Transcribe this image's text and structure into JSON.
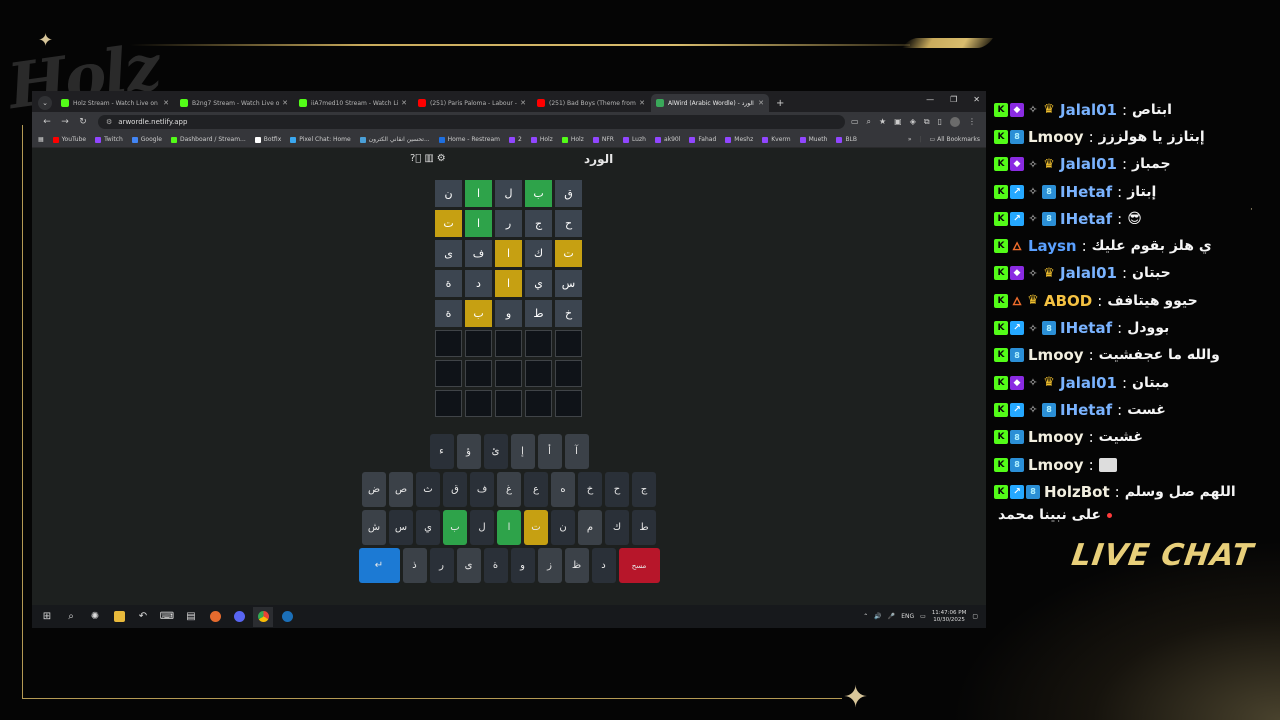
{
  "overlay": {
    "logo": "Holz",
    "live_chat_label": "LIVE CHAT",
    "gold": "#c9ab5c"
  },
  "browser": {
    "tabs": [
      {
        "title": "Holz Stream - Watch Live on Ki",
        "favicon_color": "#53fc18",
        "active": false
      },
      {
        "title": "B2ng7 Stream - Watch Live on",
        "favicon_color": "#53fc18",
        "active": false
      },
      {
        "title": "iiA7med10 Stream - Watch Live",
        "favicon_color": "#53fc18",
        "active": false
      },
      {
        "title": "(251) Paris Paloma - Labour - Y",
        "favicon_color": "#ff0000",
        "active": false
      },
      {
        "title": "(251) Bad Boys (Theme from Co",
        "favicon_color": "#ff0000",
        "active": false
      },
      {
        "title": "AlWird (Arabic Wordle) - الورد",
        "favicon_color": "#3aa85a",
        "active": true
      }
    ],
    "url": "arwordle.netlify.app",
    "bookmarks": [
      {
        "label": "YouTube",
        "color": "#ff0000"
      },
      {
        "label": "Twitch",
        "color": "#9146ff"
      },
      {
        "label": "Google",
        "color": "#4285f4"
      },
      {
        "label": "Dashboard / Stream...",
        "color": "#53fc18"
      },
      {
        "label": "Botfix",
        "color": "#ffffff"
      },
      {
        "label": "Pixel Chat: Home",
        "color": "#3aa8f0"
      },
      {
        "label": "تحسين انقاني الكترون...",
        "color": "#4aa0d8"
      },
      {
        "label": "Home - Restream",
        "color": "#1e6fe0"
      },
      {
        "label": "2",
        "color": "#9146ff"
      },
      {
        "label": "Holz",
        "color": "#9146ff"
      },
      {
        "label": "Holz",
        "color": "#53fc18"
      },
      {
        "label": "NFR",
        "color": "#9146ff"
      },
      {
        "label": "Luzh",
        "color": "#9146ff"
      },
      {
        "label": "ak90l",
        "color": "#9146ff"
      },
      {
        "label": "Fahad",
        "color": "#9146ff"
      },
      {
        "label": "Meshz",
        "color": "#9146ff"
      },
      {
        "label": "Kverm",
        "color": "#9146ff"
      },
      {
        "label": "Mueth",
        "color": "#9146ff"
      },
      {
        "label": "BLB",
        "color": "#9146ff"
      }
    ],
    "all_bookmarks": "All Bookmarks"
  },
  "game": {
    "title": "الورد",
    "rows": [
      [
        {
          "l": "ق",
          "s": "absent"
        },
        {
          "l": "ب",
          "s": "correct"
        },
        {
          "l": "ل",
          "s": "absent"
        },
        {
          "l": "ا",
          "s": "correct"
        },
        {
          "l": "ن",
          "s": "absent"
        }
      ],
      [
        {
          "l": "ح",
          "s": "absent"
        },
        {
          "l": "ج",
          "s": "absent"
        },
        {
          "l": "ر",
          "s": "absent"
        },
        {
          "l": "ا",
          "s": "correct"
        },
        {
          "l": "ت",
          "s": "present"
        }
      ],
      [
        {
          "l": "ت",
          "s": "present"
        },
        {
          "l": "ك",
          "s": "absent"
        },
        {
          "l": "ا",
          "s": "present"
        },
        {
          "l": "ف",
          "s": "absent"
        },
        {
          "l": "ى",
          "s": "absent"
        }
      ],
      [
        {
          "l": "س",
          "s": "absent"
        },
        {
          "l": "ي",
          "s": "absent"
        },
        {
          "l": "ا",
          "s": "present"
        },
        {
          "l": "د",
          "s": "absent"
        },
        {
          "l": "ة",
          "s": "absent"
        }
      ],
      [
        {
          "l": "خ",
          "s": "absent"
        },
        {
          "l": "ط",
          "s": "absent"
        },
        {
          "l": "و",
          "s": "absent"
        },
        {
          "l": "ب",
          "s": "present"
        },
        {
          "l": "ة",
          "s": "absent"
        }
      ],
      [
        {
          "l": "",
          "s": "empty"
        },
        {
          "l": "",
          "s": "empty"
        },
        {
          "l": "",
          "s": "empty"
        },
        {
          "l": "",
          "s": "empty"
        },
        {
          "l": "",
          "s": "empty"
        }
      ],
      [
        {
          "l": "",
          "s": "empty"
        },
        {
          "l": "",
          "s": "empty"
        },
        {
          "l": "",
          "s": "empty"
        },
        {
          "l": "",
          "s": "empty"
        },
        {
          "l": "",
          "s": "empty"
        }
      ],
      [
        {
          "l": "",
          "s": "empty"
        },
        {
          "l": "",
          "s": "empty"
        },
        {
          "l": "",
          "s": "empty"
        },
        {
          "l": "",
          "s": "empty"
        },
        {
          "l": "",
          "s": "empty"
        }
      ]
    ],
    "keyboard": [
      [
        {
          "k": "آ",
          "s": "absent"
        },
        {
          "k": "أ",
          "s": "absent"
        },
        {
          "k": "إ",
          "s": "absent"
        },
        {
          "k": "ئ",
          "s": "dark"
        },
        {
          "k": "ؤ",
          "s": "absent"
        },
        {
          "k": "ء",
          "s": "dark"
        }
      ],
      [
        {
          "k": "ج",
          "s": "dark"
        },
        {
          "k": "ح",
          "s": "dark"
        },
        {
          "k": "خ",
          "s": "dark"
        },
        {
          "k": "ه",
          "s": "absent"
        },
        {
          "k": "ع",
          "s": "dark"
        },
        {
          "k": "غ",
          "s": "absent"
        },
        {
          "k": "ف",
          "s": "dark"
        },
        {
          "k": "ق",
          "s": "dark"
        },
        {
          "k": "ث",
          "s": "dark"
        },
        {
          "k": "ص",
          "s": "absent"
        },
        {
          "k": "ض",
          "s": "absent"
        }
      ],
      [
        {
          "k": "ط",
          "s": "dark"
        },
        {
          "k": "ك",
          "s": "dark"
        },
        {
          "k": "م",
          "s": "absent"
        },
        {
          "k": "ن",
          "s": "dark"
        },
        {
          "k": "ت",
          "s": "present"
        },
        {
          "k": "ا",
          "s": "correct"
        },
        {
          "k": "ل",
          "s": "dark"
        },
        {
          "k": "ب",
          "s": "correct"
        },
        {
          "k": "ي",
          "s": "dark"
        },
        {
          "k": "س",
          "s": "dark"
        },
        {
          "k": "ش",
          "s": "absent"
        }
      ],
      [
        {
          "k": "مسح",
          "s": "delete"
        },
        {
          "k": "د",
          "s": "dark"
        },
        {
          "k": "ظ",
          "s": "absent"
        },
        {
          "k": "ز",
          "s": "absent"
        },
        {
          "k": "و",
          "s": "dark"
        },
        {
          "k": "ة",
          "s": "dark"
        },
        {
          "k": "ى",
          "s": "absent"
        },
        {
          "k": "ر",
          "s": "dark"
        },
        {
          "k": "ذ",
          "s": "absent"
        },
        {
          "k": "↵",
          "s": "enter"
        }
      ]
    ]
  },
  "taskbar": {
    "lang": "ENG",
    "time": "11:47:06 PM",
    "date": "10/30/2025"
  },
  "chat": [
    {
      "badges": [
        "kick",
        "gem",
        "spark",
        "crown"
      ],
      "user": "Jalal01",
      "color": "#7ab3ff",
      "text": "ابتاص"
    },
    {
      "badges": [
        "kick",
        "og"
      ],
      "user": "Lmooy",
      "color": "#f2efe0",
      "text": "إبتازز يا هولززز"
    },
    {
      "badges": [
        "kick",
        "gem",
        "spark",
        "crown"
      ],
      "user": "Jalal01",
      "color": "#7ab3ff",
      "text": "جمباز"
    },
    {
      "badges": [
        "kick",
        "sub",
        "spark",
        "og"
      ],
      "user": "IHetaf",
      "color": "#7ab3ff",
      "text": "إبتاز"
    },
    {
      "badges": [
        "kick",
        "sub",
        "spark",
        "og"
      ],
      "user": "IHetaf",
      "color": "#7ab3ff",
      "text": "😎"
    },
    {
      "badges": [
        "kick",
        "fire"
      ],
      "user": "Laysn",
      "color": "#5aa0ff",
      "text": "ي هلز بقوم عليك"
    },
    {
      "badges": [
        "kick",
        "gem",
        "spark",
        "crown"
      ],
      "user": "Jalal01",
      "color": "#7ab3ff",
      "text": "حبتان"
    },
    {
      "badges": [
        "kick",
        "fire",
        "crown"
      ],
      "user": "ABOD",
      "color": "#f5c242",
      "text": "حيوو هيتافف"
    },
    {
      "badges": [
        "kick",
        "sub",
        "spark",
        "og"
      ],
      "user": "IHetaf",
      "color": "#7ab3ff",
      "text": "بوودل"
    },
    {
      "badges": [
        "kick",
        "og"
      ],
      "user": "Lmooy",
      "color": "#f2efe0",
      "text": "والله ما عجفشيت"
    },
    {
      "badges": [
        "kick",
        "gem",
        "spark",
        "crown"
      ],
      "user": "Jalal01",
      "color": "#7ab3ff",
      "text": "مبتان"
    },
    {
      "badges": [
        "kick",
        "sub",
        "spark",
        "og"
      ],
      "user": "IHetaf",
      "color": "#7ab3ff",
      "text": "غست"
    },
    {
      "badges": [
        "kick",
        "og"
      ],
      "user": "Lmooy",
      "color": "#f2efe0",
      "text": "غشيت"
    },
    {
      "badges": [
        "kick",
        "og"
      ],
      "user": "Lmooy",
      "color": "#f2efe0",
      "text": ""
    },
    {
      "badges": [
        "kick",
        "sub",
        "og"
      ],
      "user": "HolzBot",
      "color": "#f2efe0",
      "text": "اللهم صل وسلم"
    }
  ],
  "chat_continuation": "على نبينا محمد"
}
